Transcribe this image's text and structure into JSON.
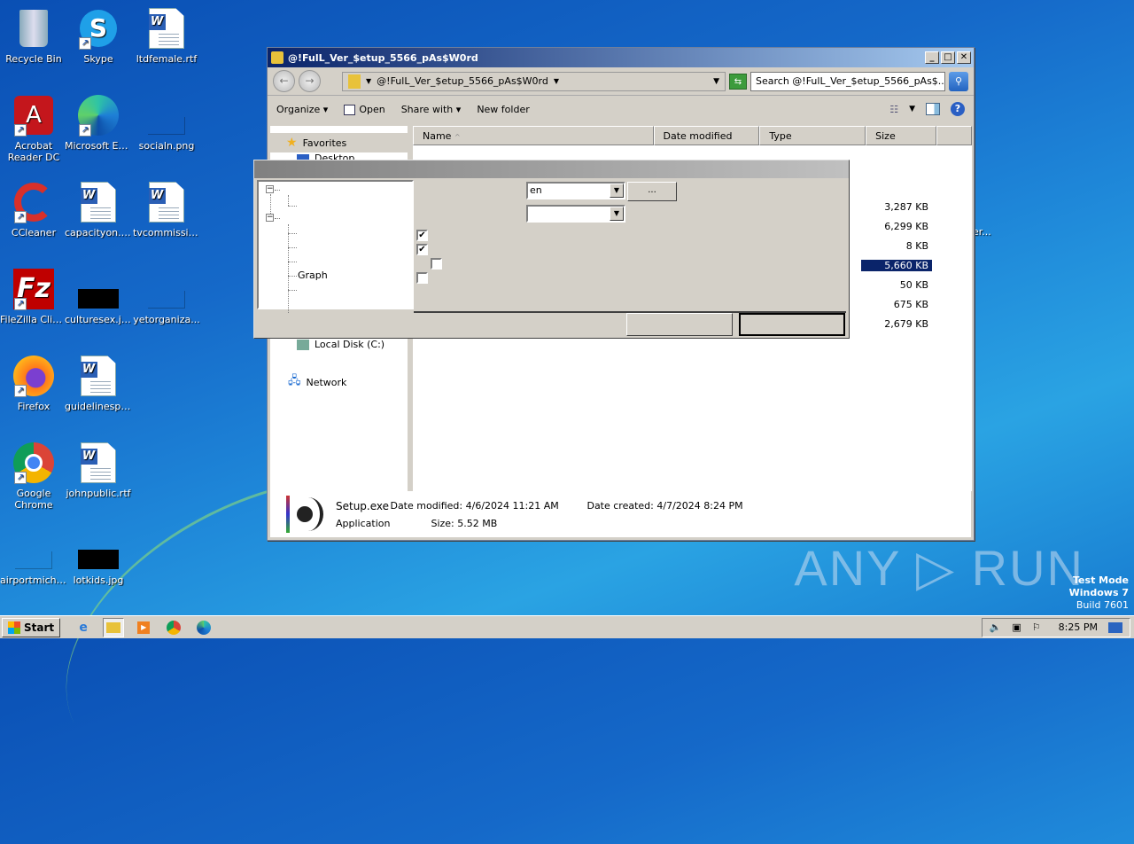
{
  "desktop": {
    "icons": [
      {
        "label": "Recycle Bin",
        "icon": "recycle-bin-icon"
      },
      {
        "label": "Skype",
        "icon": "skype-icon"
      },
      {
        "label": "ltdfemale.rtf",
        "icon": "word-doc-icon"
      },
      {
        "label": "Acrobat Reader DC",
        "icon": "acrobat-icon"
      },
      {
        "label": "Microsoft Edge",
        "icon": "edge-icon"
      },
      {
        "label": "socialn.png",
        "icon": "image-file-icon"
      },
      {
        "label": "CCleaner",
        "icon": "ccleaner-icon"
      },
      {
        "label": "capacityon.rtf",
        "icon": "word-doc-icon"
      },
      {
        "label": "tvcommissio...",
        "icon": "word-doc-icon"
      },
      {
        "label": "FileZilla Client",
        "icon": "filezilla-icon"
      },
      {
        "label": "culturesex.jpg",
        "icon": "image-file-icon"
      },
      {
        "label": "yetorganiza...",
        "icon": "image-file-icon"
      },
      {
        "label": "Firefox",
        "icon": "firefox-icon"
      },
      {
        "label": "guidelinespr...",
        "icon": "word-doc-icon"
      },
      {
        "label": "Google Chrome",
        "icon": "chrome-icon"
      },
      {
        "label": "johnpublic.rtf",
        "icon": "word-doc-icon"
      },
      {
        "label": "airportmicha...",
        "icon": "image-file-icon"
      },
      {
        "label": "lotkids.jpg",
        "icon": "image-file-icon"
      }
    ],
    "partial_label": "er..."
  },
  "explorer": {
    "title": "@!FulL_Ver_$etup_5566_pAs$W0rd",
    "address": "@!FulL_Ver_$etup_5566_pAs$W0rd",
    "search_placeholder": "Search @!FulL_Ver_$etup_5566_pAs$...",
    "toolbar": {
      "organize": "Organize",
      "open": "Open",
      "share_with": "Share with",
      "new_folder": "New folder"
    },
    "nav": {
      "favorites": "Favorites",
      "desktop": "Desktop",
      "local_disk": "Local Disk (C:)",
      "network": "Network"
    },
    "columns": [
      "Name",
      "Date modified",
      "Type",
      "Size"
    ],
    "sizes": [
      "3,287 KB",
      "6,299 KB",
      "8 KB",
      "5,660 KB",
      "50 KB",
      "675 KB",
      "2,679 KB"
    ],
    "selected_index": 3,
    "details": {
      "name": "Setup.exe",
      "type": "Application",
      "date_modified": "Date modified: 4/6/2024 11:21 AM",
      "size": "Size: 5.52 MB",
      "date_created": "Date created: 4/7/2024 8:24 PM"
    }
  },
  "dialog": {
    "tree": {
      "graph_label": "Graph"
    },
    "language_value": "en",
    "second_value": "",
    "browse_label": "...",
    "checkboxes": [
      true,
      true,
      false,
      false
    ],
    "ok_label": "",
    "cancel_label": ""
  },
  "taskbar": {
    "start": "Start",
    "clock": "8:25 PM"
  },
  "overlay": {
    "watermark": "ANY ▷ RUN",
    "test_mode": "Test Mode",
    "os": "Windows 7",
    "build": "Build 7601"
  }
}
